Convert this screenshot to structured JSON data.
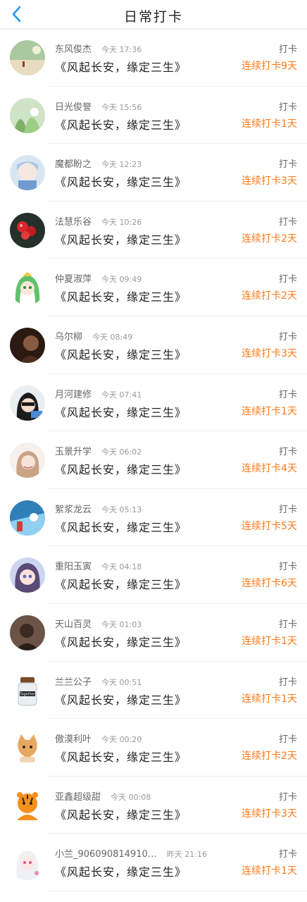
{
  "header": {
    "title": "日常打卡",
    "back_icon": "chevron-left-icon",
    "accent": "#1e96f0"
  },
  "colors": {
    "streak": "#ff7a1a"
  },
  "entries": [
    {
      "name": "东风俊杰",
      "time": "今天 17:36",
      "text": "《风起长安，缘定三生》",
      "checkin": "打卡",
      "streak": "连续打卡9天",
      "avatar": "landscape"
    },
    {
      "name": "日光俊誉",
      "time": "今天 15:56",
      "text": "《风起长安，缘定三生》",
      "checkin": "打卡",
      "streak": "连续打卡1天",
      "avatar": "greenery"
    },
    {
      "name": "魔都盼之",
      "time": "今天 12:23",
      "text": "《风起长安，缘定三生》",
      "checkin": "打卡",
      "streak": "连续打卡3天",
      "avatar": "anime-blue"
    },
    {
      "name": "法慧乐谷",
      "time": "今天 10:26",
      "text": "《风起长安，缘定三生》",
      "checkin": "打卡",
      "streak": "连续打卡2天",
      "avatar": "red-berries"
    },
    {
      "name": "仲夏淑萍",
      "time": "今天 09:49",
      "text": "《风起长安，缘定三生》",
      "checkin": "打卡",
      "streak": "连续打卡2天",
      "avatar": "anime-green"
    },
    {
      "name": "乌尔柳",
      "time": "今天 08:49",
      "text": "《风起长安，缘定三生》",
      "checkin": "打卡",
      "streak": "连续打卡3天",
      "avatar": "dark-portrait"
    },
    {
      "name": "月河建修",
      "time": "今天 07:41",
      "text": "《风起长安，缘定三生》",
      "checkin": "打卡",
      "streak": "连续打卡1天",
      "avatar": "sunglasses"
    },
    {
      "name": "玉景升学",
      "time": "今天 06:02",
      "text": "《风起长安，缘定三生》",
      "checkin": "打卡",
      "streak": "连续打卡4天",
      "avatar": "girl-light"
    },
    {
      "name": "絮浆龙云",
      "time": "今天 05:13",
      "text": "《风起长安，缘定三生》",
      "checkin": "打卡",
      "streak": "连续打卡5天",
      "avatar": "blue-scene"
    },
    {
      "name": "重阳玉寅",
      "time": "今天 04:18",
      "text": "《风起长安，缘定三生》",
      "checkin": "打卡",
      "streak": "连续打卡6天",
      "avatar": "anime-girl"
    },
    {
      "name": "天山百灵",
      "time": "今天 01:03",
      "text": "《风起长安，缘定三生》",
      "checkin": "打卡",
      "streak": "连续打卡1天",
      "avatar": "brown-portrait"
    },
    {
      "name": "兰兰公子",
      "time": "今天 00:51",
      "text": "《风起长安，缘定三生》",
      "checkin": "打卡",
      "streak": "连续打卡1天",
      "avatar": "together-jar"
    },
    {
      "name": "傲漠利叶",
      "time": "今天 00:20",
      "text": "《风起长安，缘定三生》",
      "checkin": "打卡",
      "streak": "连续打卡2天",
      "avatar": "cat"
    },
    {
      "name": "亚鑫超级甜",
      "time": "今天 00:08",
      "text": "《风起长安，缘定三生》",
      "checkin": "打卡",
      "streak": "连续打卡3天",
      "avatar": "tiger"
    },
    {
      "name": "小兰_906090814910…",
      "time": "昨天 21:16",
      "text": "《风起长安，缘定三生》",
      "checkin": "打卡",
      "streak": "连续打卡1天",
      "avatar": "white-hair-girl"
    }
  ]
}
